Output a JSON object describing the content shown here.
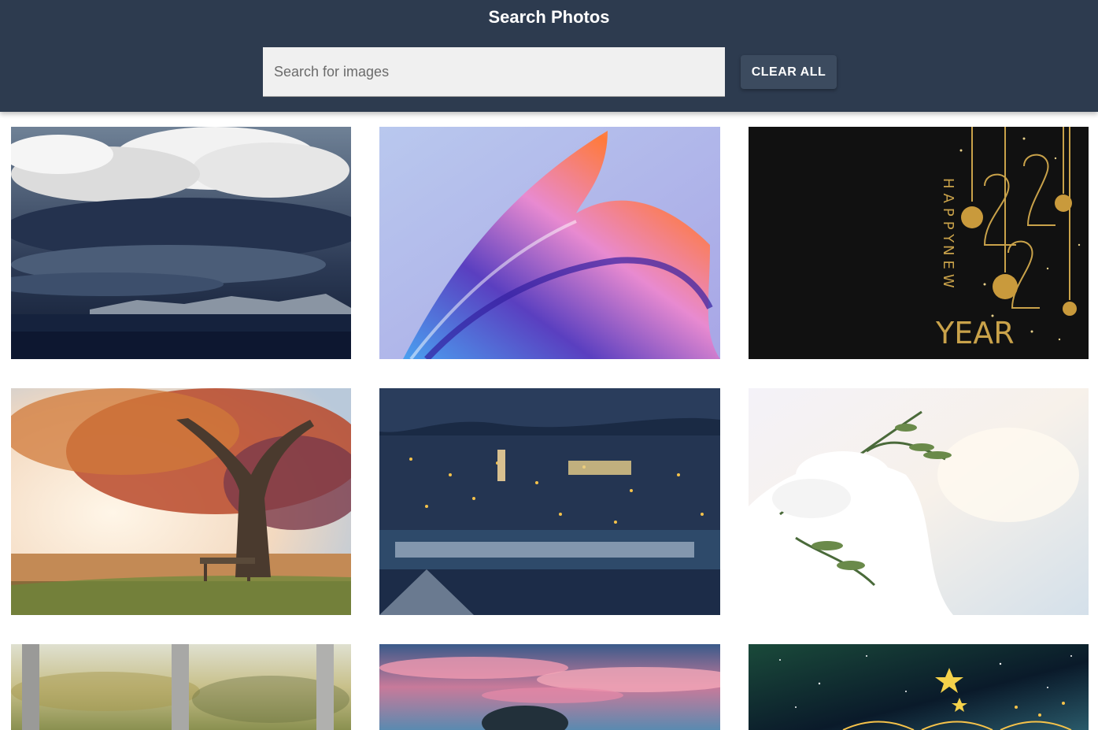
{
  "header": {
    "title": "Search Photos",
    "background": "#2d3b4f"
  },
  "search": {
    "placeholder": "Search for images",
    "value": ""
  },
  "toolbar": {
    "clear_label": "CLEAR ALL"
  },
  "photos": [
    {
      "subject": "storm clouds over lake"
    },
    {
      "subject": "abstract colorful wave"
    },
    {
      "subject": "happy new year 2022 gold ornaments",
      "text_lines": [
        "HAPPY",
        "NEW",
        "YEAR"
      ]
    },
    {
      "subject": "autumn tree with bench in fog"
    },
    {
      "subject": "town at night in winter"
    },
    {
      "subject": "snow covered evergreen branch"
    },
    {
      "subject": "blurred fence posts"
    },
    {
      "subject": "pink sunset sky with tree"
    },
    {
      "subject": "starry sky with golden stars"
    }
  ]
}
